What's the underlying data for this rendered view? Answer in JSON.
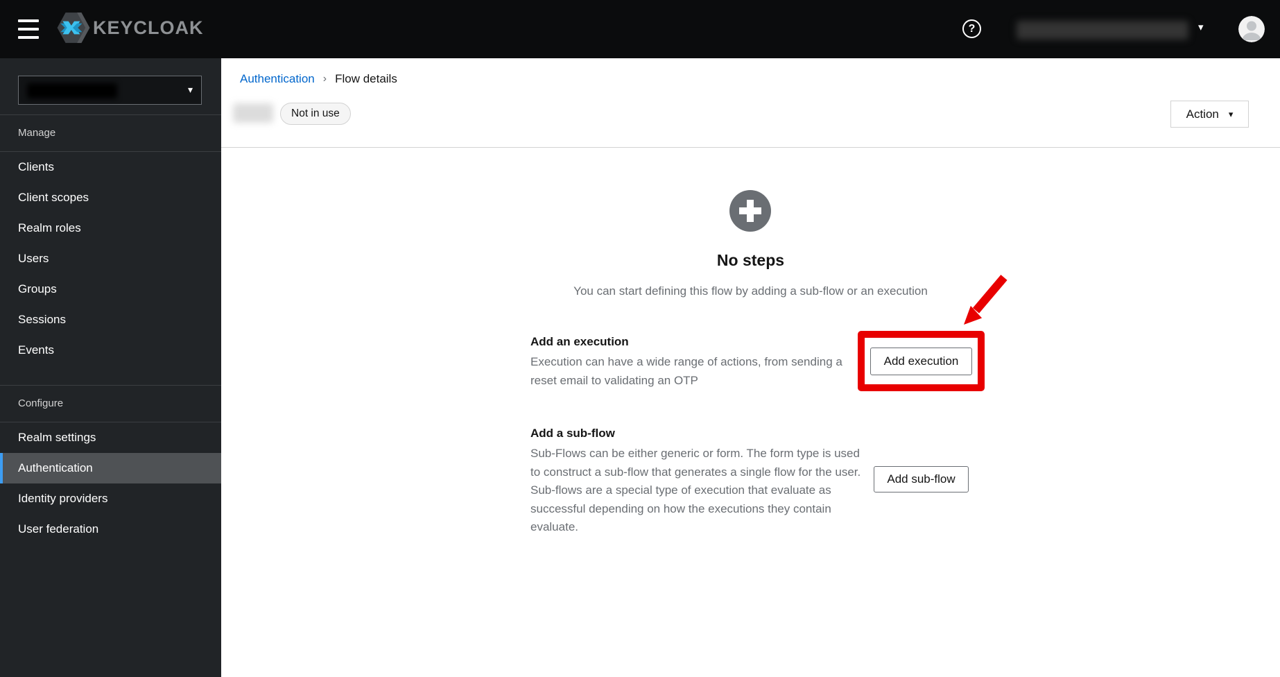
{
  "topbar": {
    "brand": "KEYCLOAK"
  },
  "icons": {
    "help": "?",
    "caret": "▾",
    "breadcrumb_sep": "›"
  },
  "sidebar": {
    "sections": [
      {
        "title": "Manage",
        "items": [
          "Clients",
          "Client scopes",
          "Realm roles",
          "Users",
          "Groups",
          "Sessions",
          "Events"
        ]
      },
      {
        "title": "Configure",
        "items": [
          "Realm settings",
          "Authentication",
          "Identity providers",
          "User federation"
        ]
      }
    ],
    "selected_item": "Authentication"
  },
  "breadcrumb": {
    "link": "Authentication",
    "current": "Flow details"
  },
  "header": {
    "badge": "Not in use",
    "action_label": "Action"
  },
  "empty_state": {
    "title": "No steps",
    "description": "You can start defining this flow by adding a sub-flow or an execution",
    "options": [
      {
        "title": "Add an execution",
        "description": "Execution can have a wide range of actions, from sending a reset email to validating an OTP",
        "button": "Add execution"
      },
      {
        "title": "Add a sub-flow",
        "description": "Sub-Flows can be either generic or form. The form type is used to construct a sub-flow that generates a single flow for the user. Sub-flows are a special type of execution that evaluate as successful depending on how the executions they contain evaluate.",
        "button": "Add sub-flow"
      }
    ]
  },
  "colors": {
    "accent_blue": "#3d9df2",
    "link_blue": "#0066cc",
    "annotation_red": "#e80000"
  }
}
